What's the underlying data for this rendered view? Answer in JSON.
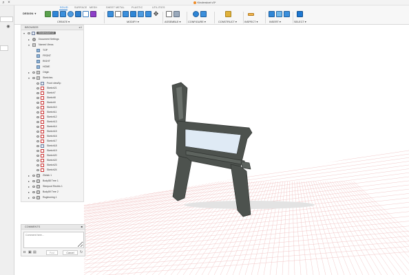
{
  "window": {
    "doc_title": "Kinderstoel v3*"
  },
  "toolbar": {
    "workspace_label": "DESIGN",
    "tabs": [
      "SOLID",
      "SURFACE",
      "MESH",
      "SHEET METAL",
      "PLASTIC",
      "UTILITIES"
    ],
    "active_tab": "SOLID",
    "groups": {
      "create": "CREATE ▾",
      "modify": "MODIFY ▾",
      "assemble": "ASSEMBLE ▾",
      "configure": "CONFIGURE ▾",
      "construct": "CONSTRUCT ▾",
      "inspect": "INSPECT ▾",
      "insert": "INSERT ▾",
      "select": "SELECT ▾"
    },
    "accent_color": "#0a6fd4"
  },
  "browser": {
    "title": "BROWSER",
    "root_label": "Kinderstoel v3",
    "items": {
      "document_settings": "Document Settings",
      "named_views": "Named Views",
      "top": "TOP",
      "front": "FRONT",
      "right": "RIGHT",
      "home": "HOME",
      "origin": "Origin",
      "sketches": "Sketches",
      "front_view": "Front viewSp",
      "s21": "Sketch21",
      "s7": "Sketch7",
      "s8": "Sketch8",
      "s9": "Sketch9",
      "s10": "Sketch10",
      "s11": "Sketch11",
      "s12": "Sketch12",
      "s13": "Sketch13",
      "s14": "Sketch14",
      "s15": "Sketch15",
      "s16": "Sketch16",
      "s17": "Sketch17",
      "s18": "Sketch18",
      "s19": "Sketch19",
      "s20": "Sketch20",
      "s22": "Sketch22",
      "s23": "Sketch23",
      "s24": "Sketch24",
      "zitvlak": "Zitvlak 1",
      "body1": "Body58 Tree 1",
      "body2": "Steepoot Rechts 1",
      "body3": "Body59 Tree 2",
      "body4": "Rugleuning 1"
    }
  },
  "comments": {
    "title": "COMMENTS",
    "placeholder": "Comment here...",
    "post_label": "Post",
    "cancel_label": "Cancel"
  },
  "viewport": {
    "model_color": "#4d524e",
    "glass_color": "#dfeaf5",
    "grid_color": "#e9a2a2"
  }
}
